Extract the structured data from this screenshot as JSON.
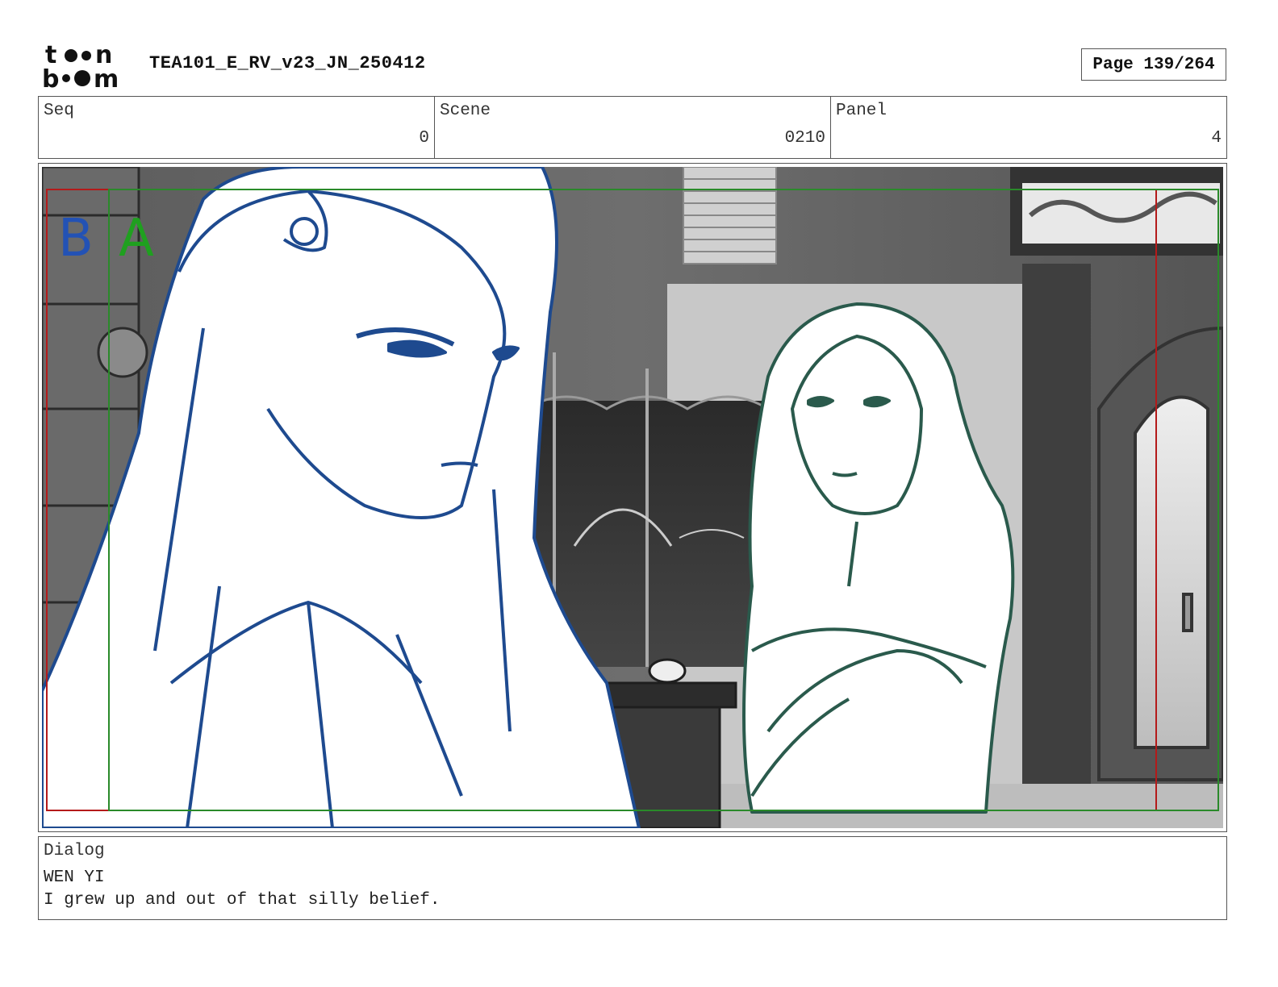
{
  "header": {
    "logo_icon": "toon-boom-logo",
    "doc_title": "TEA101_E_RV_v23_JN_250412",
    "page_label": "Page 139/264"
  },
  "info": {
    "seq_label": "Seq",
    "seq_value": "0",
    "scene_label": "Scene",
    "scene_value": "0210",
    "panel_label": "Panel",
    "panel_value": "4"
  },
  "panel": {
    "layer_b": "B",
    "layer_a": "A",
    "colors": {
      "layer_b": "#2352b5",
      "layer_a": "#1fa01f",
      "safe_frame": "#b41a1a",
      "field_frame": "#2a8a2a",
      "character_left": "#1e4a8f",
      "character_right": "#2a5a4c"
    }
  },
  "dialog": {
    "label": "Dialog",
    "speaker": "WEN YI",
    "line": "I grew up and out of that silly belief."
  }
}
